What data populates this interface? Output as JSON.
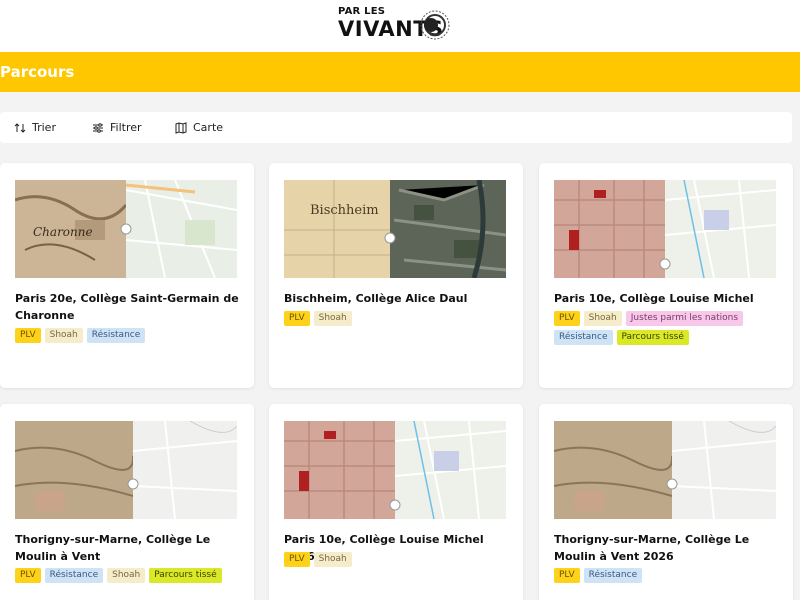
{
  "logo": {
    "line1": "PAR LES",
    "line2": "VIVANTS"
  },
  "page": {
    "title": "Parcours"
  },
  "toolbar": {
    "sort_label": "Trier",
    "filter_label": "Filtrer",
    "map_label": "Carte"
  },
  "colors": {
    "accent": "#ffc700",
    "background": "#f3f3f3"
  },
  "cards": [
    {
      "title": "Paris 20e, Collège Saint-Germain de Charonne",
      "map_left": "Charonne",
      "tags": [
        "PLV",
        "Shoah",
        "Résistance"
      ]
    },
    {
      "title": "Bischheim, Collège Alice Daul",
      "map_left": "Bischheim",
      "tags": [
        "PLV",
        "Shoah"
      ]
    },
    {
      "title": "Paris 10e, Collège Louise Michel",
      "tags": [
        "PLV",
        "Shoah",
        "Justes parmi les nations",
        "Résistance",
        "Parcours tissé"
      ]
    },
    {
      "title": "Thorigny-sur-Marne, Collège Le Moulin à Vent",
      "tags": [
        "PLV",
        "Résistance",
        "Shoah",
        "Parcours tissé"
      ]
    },
    {
      "title": "Paris 10e, Collège Louise Michel 2026",
      "tags": [
        "PLV",
        "Shoah"
      ]
    },
    {
      "title": "Thorigny-sur-Marne, Collège Le Moulin à Vent 2026",
      "tags": [
        "PLV",
        "Résistance"
      ]
    }
  ]
}
